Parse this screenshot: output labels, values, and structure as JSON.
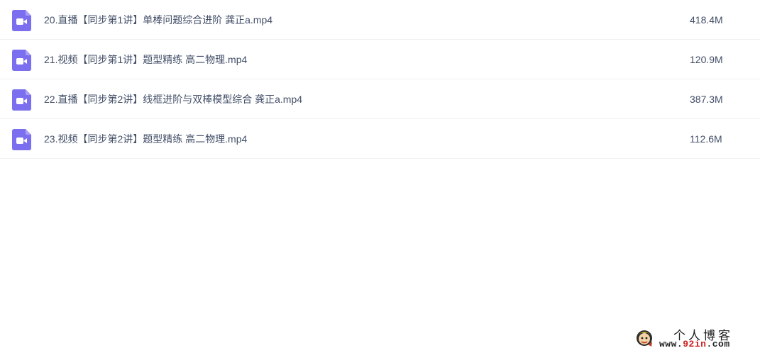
{
  "files": [
    {
      "icon": "video-file-icon",
      "name": "20.直播【同步第1讲】单棒问题综合进阶 龚正a.mp4",
      "size": "418.4M"
    },
    {
      "icon": "video-file-icon",
      "name": "21.视频【同步第1讲】题型精练 高二物理.mp4",
      "size": "120.9M"
    },
    {
      "icon": "video-file-icon",
      "name": "22.直播【同步第2讲】线框进阶与双棒模型综合 龚正a.mp4",
      "size": "387.3M"
    },
    {
      "icon": "video-file-icon",
      "name": "23.视频【同步第2讲】题型精练 高二物理.mp4",
      "size": "112.6M"
    }
  ],
  "watermark": {
    "title": "个人博客",
    "url_prefix": "www.",
    "url_accent": "92in",
    "url_suffix": ".com"
  },
  "colors": {
    "icon_purple": "#7b6ff0",
    "text": "#424e67",
    "divider": "#f0f0f2",
    "watermark_accent": "#cc1f1f"
  }
}
